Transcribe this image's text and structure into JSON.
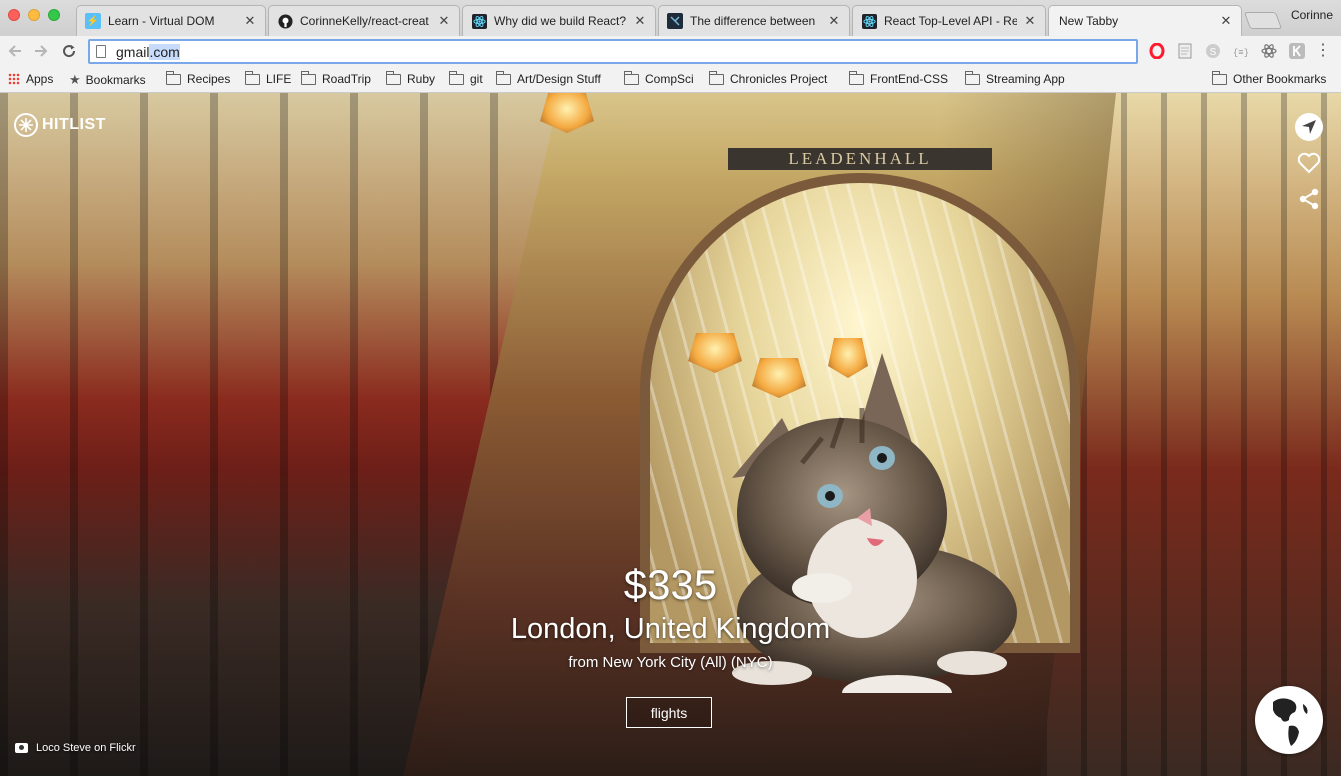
{
  "tabs": [
    {
      "title": "Learn - Virtual DOM",
      "favicon": "bolt-icon",
      "favicon_color": "#5bc0f8"
    },
    {
      "title": "CorinneKelly/react-creat",
      "favicon": "github-icon",
      "favicon_color": "#222222"
    },
    {
      "title": "Why did we build React?",
      "favicon": "react-icon",
      "favicon_color": "#61dafb"
    },
    {
      "title": "The difference between",
      "favicon": "codeschool-icon",
      "favicon_color": "#1d2b3a"
    },
    {
      "title": "React Top-Level API - Re",
      "favicon": "react-icon",
      "favicon_color": "#61dafb"
    },
    {
      "title": "New Tabby",
      "favicon": "",
      "favicon_color": ""
    }
  ],
  "active_tab_index": 5,
  "profile_name": "Corinne",
  "omnibox": {
    "url_prefix": "gmail",
    "url_completion": ".com"
  },
  "bookmarks": {
    "apps_label": "Apps",
    "bookmarks_label": "Bookmarks",
    "folders": [
      "Recipes",
      "LIFE",
      "RoadTrip",
      "Ruby",
      "git",
      "Art/Design Stuff",
      "CompSci",
      "Chronicles Project",
      "FrontEnd-CSS",
      "Streaming App"
    ],
    "other_label": "Other Bookmarks"
  },
  "page": {
    "brand": "HITLIST",
    "sign_text": "LEADENHALL",
    "price": "$335",
    "destination": "London, United Kingdom",
    "origin": "from New York City (All) (NYC)",
    "flights_label": "flights",
    "photo_credit": "Loco Steve on Flickr"
  },
  "colors": {
    "accent_blue": "#7aa7e9",
    "opera_red": "#ff1b2d"
  }
}
